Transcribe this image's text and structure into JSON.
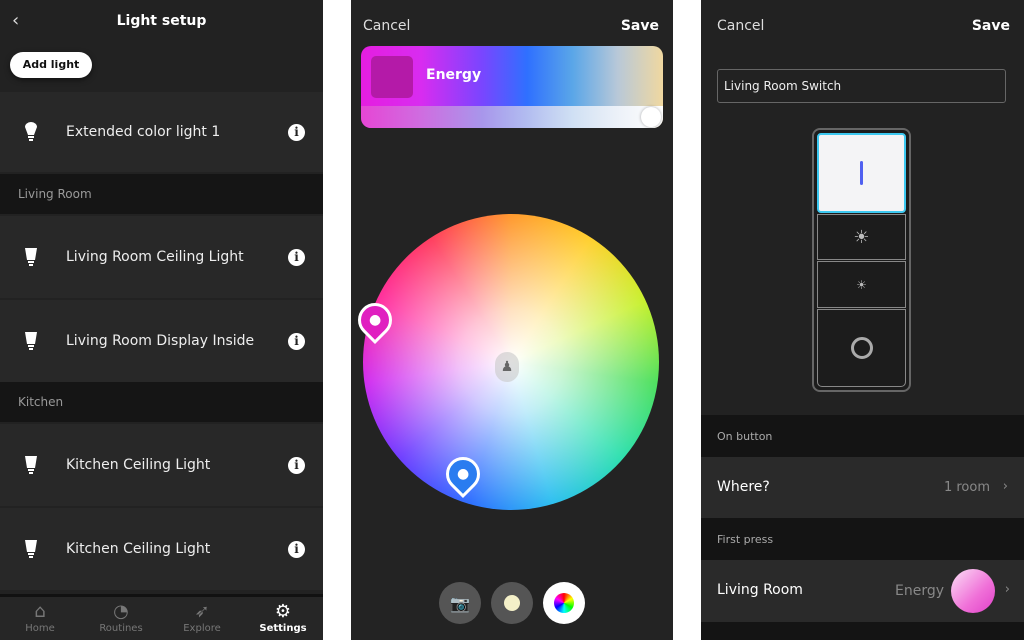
{
  "light_setup": {
    "title": "Light setup",
    "back_icon": "chevron-left-icon",
    "add_light": "Add light",
    "ungrouped": [
      {
        "label": "Extended color light 1",
        "icon": "bulb-icon"
      }
    ],
    "sections": [
      {
        "title": "Living Room",
        "items": [
          {
            "label": "Living Room Ceiling Light"
          },
          {
            "label": "Living Room Display Inside"
          }
        ]
      },
      {
        "title": "Kitchen",
        "items": [
          {
            "label": "Kitchen Ceiling Light"
          },
          {
            "label": "Kitchen Ceiling Light"
          }
        ]
      }
    ],
    "info_glyph": "i",
    "tabs": [
      {
        "label": "Home",
        "icon": "home-icon"
      },
      {
        "label": "Routines",
        "icon": "clock-icon"
      },
      {
        "label": "Explore",
        "icon": "rocket-icon"
      },
      {
        "label": "Settings",
        "icon": "gear-icon",
        "active": true
      }
    ]
  },
  "color_picker": {
    "cancel": "Cancel",
    "save": "Save",
    "scene_name": "Energy",
    "brightness": 1.0,
    "accent_pin_color": "#e020c0",
    "blue_pin_color": "#2a7cf0",
    "bottom_buttons": [
      {
        "icon": "camera-icon"
      },
      {
        "icon": "white-bulb-icon"
      },
      {
        "icon": "color-wheel-icon",
        "active": true
      }
    ]
  },
  "switch_setup": {
    "cancel": "Cancel",
    "save": "Save",
    "name_value": "Living Room Switch",
    "on_button_header": "On button",
    "where_label": "Where?",
    "where_value": "1 room",
    "first_press_header": "First press",
    "press_room": "Living Room",
    "press_scene": "Energy"
  }
}
